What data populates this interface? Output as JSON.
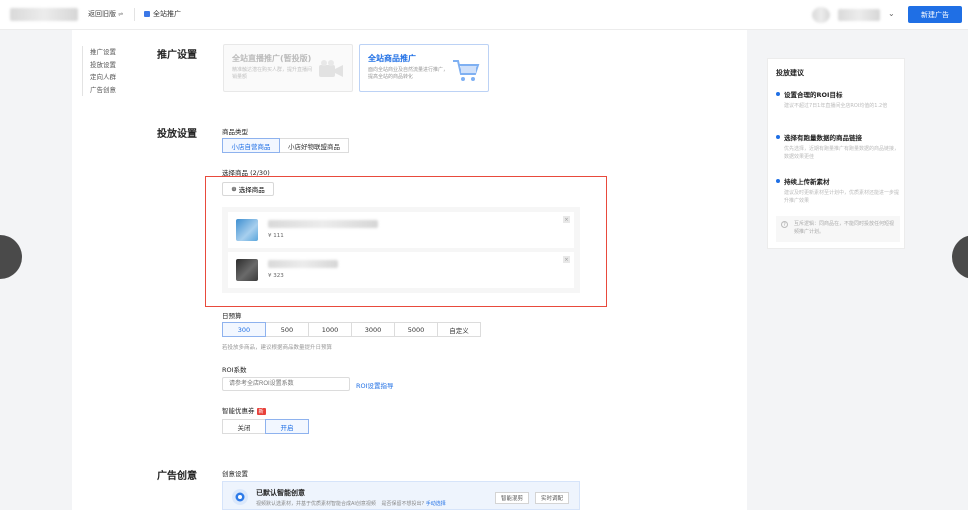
{
  "topbar": {
    "back_label": "返回旧版",
    "back_chevron": "⇌",
    "crumb": "全站推广",
    "account_chevron": "⌄",
    "new_ad_button": "新建广告"
  },
  "side_nav": [
    "推广设置",
    "投放设置",
    "定向人群",
    "广告创意"
  ],
  "sections": {
    "promo": "推广设置",
    "delivery": "投放设置",
    "creative": "广告创意"
  },
  "promo_cards": [
    {
      "title": "全站直播推广(暂投版)",
      "desc": "精准触达潜在购买人群，提升直播间销量额"
    },
    {
      "title": "全站商品推广",
      "desc": "面向全站商业及自然流量进行推广，提高全站的商品转化"
    }
  ],
  "product_type": {
    "label": "商品类型",
    "options": [
      "小店自营商品",
      "小店好物联盟商品"
    ],
    "selected": 0
  },
  "select_products": {
    "label": "选择商品 (2/30)",
    "button": "选择商品",
    "plus_icon": "⊕",
    "close_glyph": "×",
    "items": [
      {
        "price": "¥ 111"
      },
      {
        "price": "¥ 323"
      }
    ]
  },
  "daily_budget": {
    "label": "日预算",
    "options": [
      "300",
      "500",
      "1000",
      "3000",
      "5000",
      "自定义"
    ],
    "selected": 0,
    "hint": "若投放多商品，建议根据商品数量提升日预算"
  },
  "roi": {
    "label": "ROI系数",
    "placeholder": "请参考全店ROI设置系数",
    "guide_link": "ROI设置指导"
  },
  "coupon": {
    "label": "智能优惠券",
    "new_tag": "新",
    "options": [
      "关闭",
      "开启"
    ],
    "selected": 1
  },
  "creative": {
    "label": "创意设置",
    "banner_title": "已默认智能创意",
    "banner_desc": "视频默认选素材，并基于优质素材智能合成AI创意视频",
    "banner_question": "是否保留不想投出?",
    "banner_link": "手动选择",
    "banner_buttons": [
      "智能混剪",
      "实时调配"
    ]
  },
  "right_panel": {
    "title": "投放建议",
    "tips": [
      {
        "title": "设置合理的ROI目标",
        "body": "建议不超过7日1年直播间全店ROI均值的1.2倍"
      },
      {
        "title": "选择有跑量数据的商品链接",
        "body": "优先选择，近期有跑量推广有跑量数据的商品链接，数据效果更佳"
      },
      {
        "title": "持续上传新素材",
        "body": "建议及时更新素材至计划中，优质素材还能进一步提升推广效果"
      }
    ],
    "note_icon": "?",
    "note": "互斥逻辑：同商品在，不能同时投放任何短视频推广计划。"
  },
  "colors": {
    "accent": "#1f6fe5",
    "highlight_box": "#e84a3c",
    "new_tag": "#e8413a"
  }
}
